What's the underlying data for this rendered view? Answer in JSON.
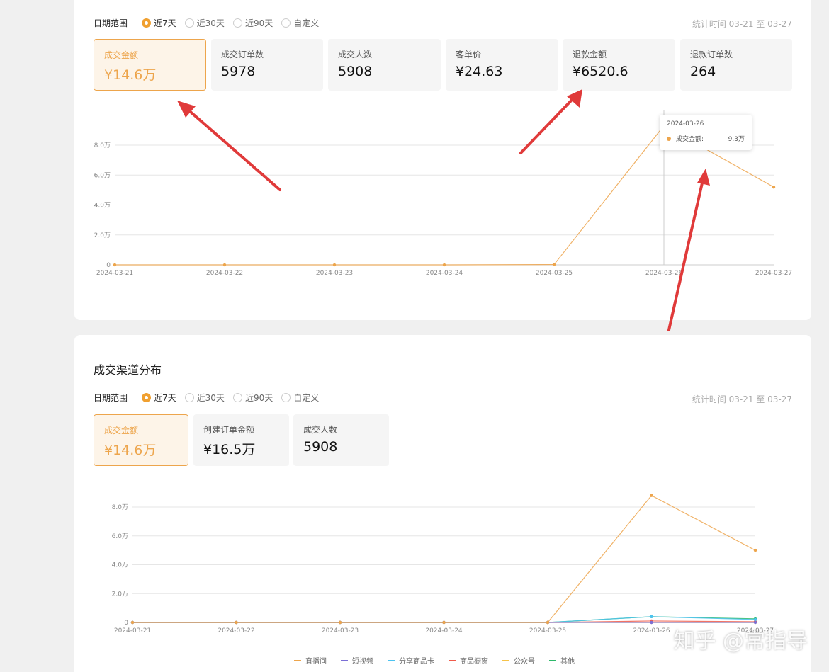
{
  "top_panel": {
    "filter": {
      "label": "日期范围",
      "options": [
        "近7天",
        "近30天",
        "近90天",
        "自定义"
      ],
      "selected_index": 0
    },
    "stat_time": "统计时间 03-21 至 03-27",
    "metrics": [
      {
        "label": "成交金额",
        "value": "¥14.6万",
        "active": true
      },
      {
        "label": "成交订单数",
        "value": "5978"
      },
      {
        "label": "成交人数",
        "value": "5908"
      },
      {
        "label": "客单价",
        "value": "¥24.63"
      },
      {
        "label": "退款金额",
        "value": "¥6520.6"
      },
      {
        "label": "退款订单数",
        "value": "264"
      }
    ],
    "tooltip": {
      "date": "2024-03-26",
      "series": "成交金额:",
      "value": "9.3万"
    }
  },
  "bottom_panel": {
    "title": "成交渠道分布",
    "filter": {
      "label": "日期范围",
      "options": [
        "近7天",
        "近30天",
        "近90天",
        "自定义"
      ],
      "selected_index": 0
    },
    "stat_time": "统计时间 03-21 至 03-27",
    "metrics": [
      {
        "label": "成交金额",
        "value": "¥14.6万",
        "active": true
      },
      {
        "label": "创建订单金额",
        "value": "¥16.5万"
      },
      {
        "label": "成交人数",
        "value": "5908"
      }
    ]
  },
  "watermark": "知乎 @常指导",
  "colors": {
    "accent": "#eda54c",
    "arrow": "#e03a3a"
  },
  "chart_data": [
    {
      "type": "line",
      "x": [
        "2024-03-21",
        "2024-03-22",
        "2024-03-23",
        "2024-03-24",
        "2024-03-25",
        "2024-03-26",
        "2024-03-27"
      ],
      "yticks": [
        "0",
        "2.0万",
        "4.0万",
        "6.0万",
        "8.0万"
      ],
      "ylim": [
        0,
        8
      ],
      "series": [
        {
          "name": "成交金额",
          "color": "#eda54c",
          "values": [
            0,
            0,
            0,
            0,
            0.02,
            9.3,
            5.2
          ]
        }
      ],
      "grid": true
    },
    {
      "type": "line",
      "x": [
        "2024-03-21",
        "2024-03-22",
        "2024-03-23",
        "2024-03-24",
        "2024-03-25",
        "2024-03-26",
        "2024-03-27"
      ],
      "yticks": [
        "0",
        "2.0万",
        "4.0万",
        "6.0万",
        "8.0万"
      ],
      "ylim": [
        0,
        8
      ],
      "legend_position": "bottom",
      "series": [
        {
          "name": "直播间",
          "color": "#eda54c",
          "values": [
            0,
            0,
            0,
            0,
            0,
            8.8,
            5.0
          ]
        },
        {
          "name": "短视频",
          "color": "#7b6fd6",
          "values": [
            0,
            0,
            0,
            0,
            0,
            0,
            0
          ]
        },
        {
          "name": "分享商品卡",
          "color": "#4cc3f0",
          "values": [
            0,
            0,
            0,
            0,
            0,
            0.4,
            0.2
          ]
        },
        {
          "name": "商品橱窗",
          "color": "#f05a4a",
          "values": [
            0,
            0,
            0,
            0,
            0,
            0.1,
            0.05
          ]
        },
        {
          "name": "公众号",
          "color": "#f6c34a",
          "values": [
            0,
            0,
            0,
            0,
            0,
            0,
            0
          ]
        },
        {
          "name": "其他",
          "color": "#2db86a",
          "values": [
            0,
            0,
            0,
            0,
            0,
            0.4,
            0.25
          ]
        }
      ],
      "grid": true
    }
  ]
}
